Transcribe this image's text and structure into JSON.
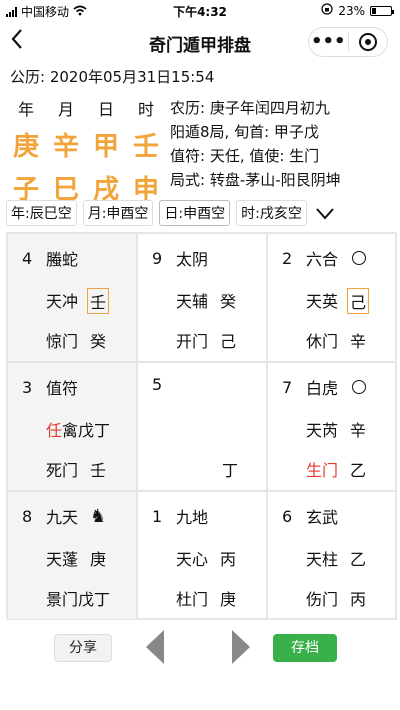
{
  "status": {
    "carrier": "中国移动",
    "time": "下午4:32",
    "battery": "23%",
    "battery_level": 0.23
  },
  "nav": {
    "title": "奇门遁甲排盘"
  },
  "gongli": "公历: 2020年05月31日15:54",
  "pillars": {
    "heads": [
      "年",
      "月",
      "日",
      "时"
    ],
    "stems": [
      "庚",
      "辛",
      "甲",
      "壬"
    ],
    "branches": [
      "子",
      "巳",
      "戌",
      "申"
    ]
  },
  "details": [
    "农历: 庚子年闰四月初九",
    "阳遁8局, 旬首: 甲子戊",
    "值符: 天任, 值使: 生门",
    "局式: 转盘-茅山-阳艮阴坤"
  ],
  "kongs": [
    "年:辰巳空",
    "月:申酉空",
    "日:申酉空",
    "时:戌亥空"
  ],
  "cells": [
    {
      "num": "4",
      "god": "螣蛇",
      "star": "天冲",
      "star_stem": "壬",
      "door": "惊门",
      "door_stem": "癸"
    },
    {
      "num": "9",
      "god": "太阴",
      "star": "天辅",
      "star_stem": "癸",
      "door": "开门",
      "door_stem": "己"
    },
    {
      "num": "2",
      "god": "六合",
      "star": "天英",
      "star_stem": "己",
      "door": "休门",
      "door_stem": "辛"
    },
    {
      "num": "3",
      "god": "值符",
      "star_mark": "任",
      "star": "禽戊丁",
      "door": "死门",
      "door_stem": "壬"
    },
    {
      "num": "5",
      "center_stem": "丁"
    },
    {
      "num": "7",
      "god": "白虎",
      "star": "天芮",
      "star_stem": "辛",
      "door": "生门",
      "door_stem": "乙"
    },
    {
      "num": "8",
      "god": "九天",
      "star": "天蓬",
      "star_stem": "庚",
      "door": "景门戊丁"
    },
    {
      "num": "1",
      "god": "九地",
      "star": "天心",
      "star_stem": "丙",
      "door": "杜门",
      "door_stem": "庚"
    },
    {
      "num": "6",
      "god": "玄武",
      "star": "天柱",
      "star_stem": "乙",
      "door": "伤门",
      "door_stem": "丙"
    }
  ],
  "bottom": {
    "share": "分享",
    "save": "存档"
  },
  "colors": {
    "accent": "#f2a43a",
    "save": "#39b04a",
    "red": "#e03b2e"
  }
}
